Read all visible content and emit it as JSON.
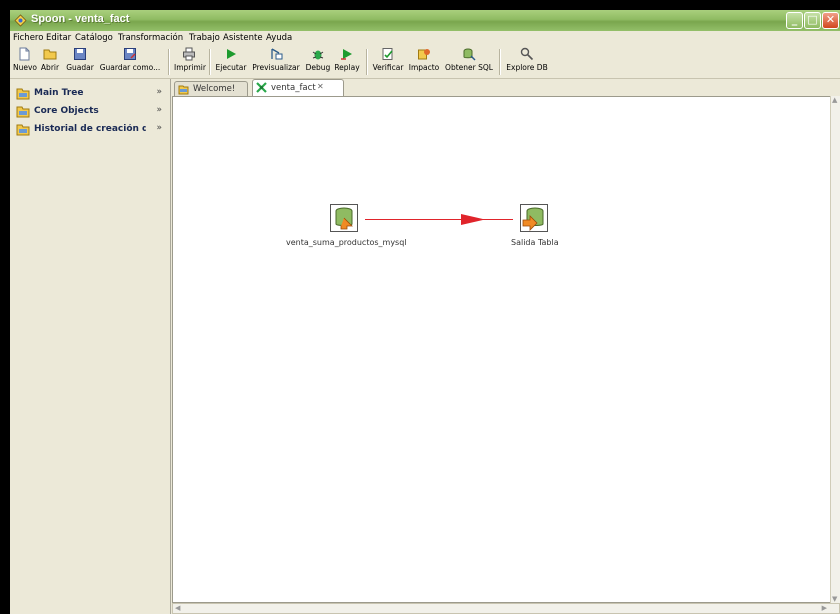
{
  "window": {
    "title": "Spoon - venta_fact"
  },
  "menu": [
    "Fichero",
    "Editar",
    "Catálogo",
    "Transformación",
    "Trabajo",
    "Asistente",
    "Ayuda"
  ],
  "toolbar": {
    "nuevo": "Nuevo",
    "abrir": "Abrir",
    "guardar": "Guadar",
    "guardar_como": "Guardar como...",
    "imprimir": "Imprimir",
    "ejecutar": "Ejecutar",
    "previsualizar": "Previsualizar",
    "debug": "Debug",
    "replay": "Replay",
    "verificar": "Verificar",
    "impacto": "Impacto",
    "obtener_sql": "Obtener SQL",
    "explore_db": "Explore DB"
  },
  "sidebar": {
    "items": [
      {
        "label": "Main Tree"
      },
      {
        "label": "Core Objects"
      },
      {
        "label": "Historial de creación d"
      }
    ]
  },
  "tabs": [
    {
      "label": "Welcome!"
    },
    {
      "label": "venta_fact"
    }
  ],
  "canvas": {
    "steps": [
      {
        "label": "venta_suma_productos_mysql"
      },
      {
        "label": "Salida Tabla"
      }
    ]
  },
  "colors": {
    "titlebar": "#8fbb62",
    "hop": "#e0242b",
    "canvas_bg": "#ffffff"
  }
}
